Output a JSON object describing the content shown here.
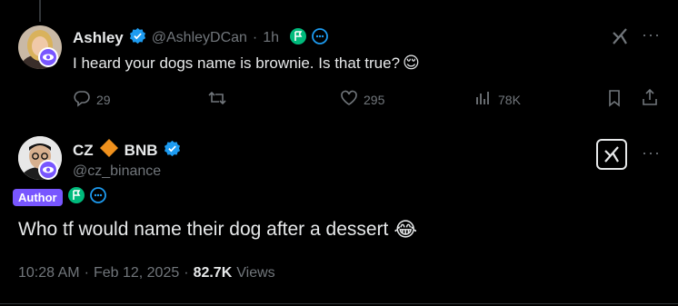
{
  "reply": {
    "display_name": "Ashley",
    "handle": "@AshleyDCan",
    "dot": "·",
    "time": "1h",
    "text": "I heard your dogs name is brownie. Is that true?",
    "emoji": "😌",
    "stats": {
      "replies": "29",
      "likes": "295",
      "views": "78K"
    }
  },
  "main": {
    "display_name_a": "CZ",
    "display_name_b": "BNB",
    "handle": "@cz_binance",
    "author_label": "Author",
    "text": "Who tf would name their dog after a dessert",
    "emoji": "😂",
    "timestamp_time": "10:28 AM",
    "timestamp_sep": "·",
    "timestamp_date": "Feb 12, 2025",
    "views_sep": "·",
    "views_count": "82.7K",
    "views_label": "Views"
  },
  "icons": {
    "more": "···",
    "verified": "verified-check-icon",
    "grok": "grok-icon"
  },
  "colors": {
    "background": "#000000",
    "verified_blue": "#1d9bf0",
    "muted": "#71767b",
    "author_purple": "#7856ff",
    "green_badge": "#00ba7c",
    "bnb_orange": "#f0911d"
  }
}
